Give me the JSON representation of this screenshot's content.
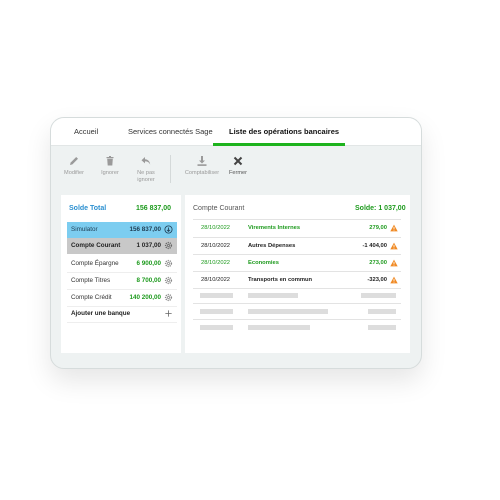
{
  "tabs": [
    {
      "label": "Accueil"
    },
    {
      "label": "Services connectés Sage"
    },
    {
      "label": "Liste des opérations bancaires",
      "active": true
    }
  ],
  "toolbar": {
    "modifier": "Modifier",
    "ignorer": "Ignorer",
    "ne_pas_ignorer": "Ne pas ignorer",
    "comptabiliser": "Comptabiliser",
    "fermer": "Fermer"
  },
  "accounts_panel": {
    "total_label": "Solde Total",
    "total_value": "156 837,00",
    "accounts": [
      {
        "name": "Simulator",
        "value": "156 837,00",
        "icon": "arrow-circle-icon"
      },
      {
        "name": "Compte Courant",
        "value": "1 037,00",
        "icon": "gear-icon"
      },
      {
        "name": "Compte Épargne",
        "value": "6 900,00",
        "icon": "gear-icon"
      },
      {
        "name": "Compte Titres",
        "value": "8 700,00",
        "icon": "gear-icon"
      },
      {
        "name": "Compte Crédit",
        "value": "140 200,00",
        "icon": "gear-icon"
      }
    ],
    "add_bank": "Ajouter une banque"
  },
  "operations_panel": {
    "account_label": "Compte Courant",
    "solde": "Solde: 1 037,00",
    "operations": [
      {
        "date": "28/10/2022",
        "label": "Virements Internes",
        "amount": "279,00",
        "type": "credit"
      },
      {
        "date": "28/10/2022",
        "label": "Autres Dépenses",
        "amount": "-1 404,00",
        "type": "debit"
      },
      {
        "date": "28/10/2022",
        "label": "Economies",
        "amount": "273,00",
        "type": "credit"
      },
      {
        "date": "28/10/2022",
        "label": "Transports en commun",
        "amount": "-323,00",
        "type": "debit"
      }
    ]
  },
  "colors": {
    "accent_green": "#1db31d",
    "positive_green": "#1d9a1d",
    "link_blue": "#2a8fd0",
    "selected_blue": "#7ccdf0",
    "selected_gray": "#c8c8c8",
    "warning_orange": "#f08a24"
  }
}
